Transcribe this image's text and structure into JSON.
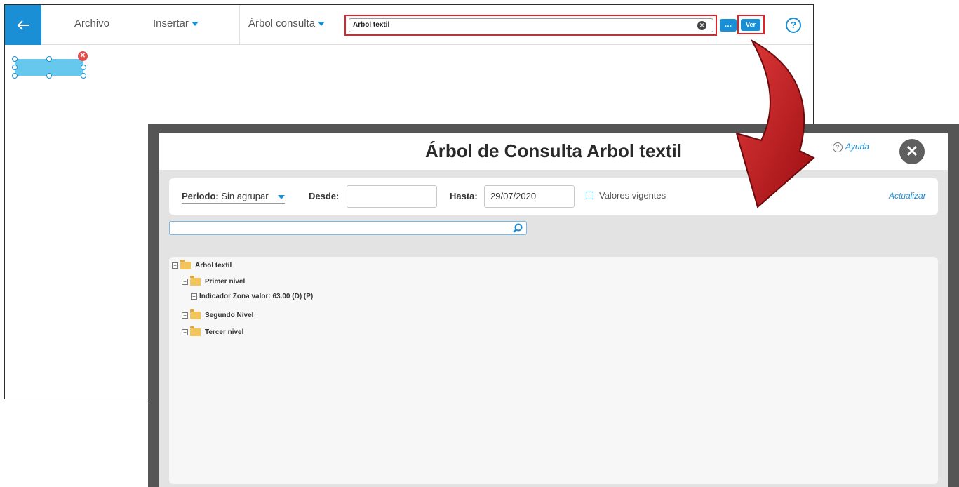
{
  "editor": {
    "menu": {
      "archivo": "Archivo",
      "insertar": "Insertar",
      "arbol_consulta": "Árbol consulta"
    },
    "search": {
      "value": "Arbol textil"
    },
    "more_label": "…",
    "ver_label": "Ver",
    "help_symbol": "?"
  },
  "dialog": {
    "title": "Árbol de Consulta Arbol textil",
    "ayuda": "Ayuda",
    "close_symbol": "✕",
    "filters": {
      "periodo_label": "Periodo:",
      "periodo_value": "Sin agrupar",
      "desde_label": "Desde:",
      "desde_value": "",
      "hasta_label": "Hasta:",
      "hasta_value": "29/07/2020",
      "vigentes_label": "Valores vigentes",
      "actualizar": "Actualizar"
    },
    "tree": {
      "nodes": [
        {
          "label": "Arbol textil",
          "expander": "−"
        },
        {
          "label": "Primer nivel",
          "expander": "−"
        },
        {
          "label": "Indicador Zona  valor: 63.00 (D) (P)",
          "expander": "+"
        },
        {
          "label": "Segundo Nivel",
          "expander": "−"
        },
        {
          "label": "Tercer nivel",
          "expander": "−"
        }
      ]
    }
  },
  "colors": {
    "accent": "#1a8fd6",
    "highlight": "#e0242c",
    "arrow": "#c8161d"
  },
  "icons": [
    "back-arrow-icon",
    "caret-down-icon",
    "clear-icon",
    "help-circle-icon",
    "close-icon",
    "search-icon",
    "folder-icon",
    "expander-icon"
  ]
}
